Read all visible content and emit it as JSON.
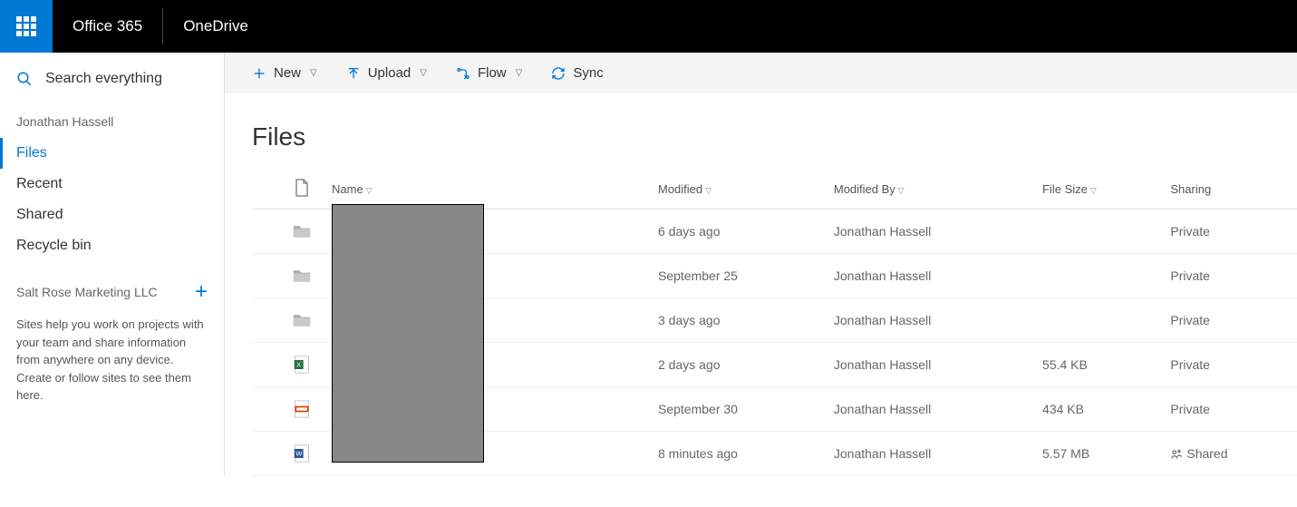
{
  "header": {
    "brand": "Office 365",
    "app": "OneDrive"
  },
  "search": {
    "placeholder": "Search everything"
  },
  "sidebar": {
    "owner": "Jonathan Hassell",
    "nav": [
      "Files",
      "Recent",
      "Shared",
      "Recycle bin"
    ],
    "group_label": "Salt Rose Marketing LLC",
    "help": "Sites help you work on projects with your team and share information from anywhere on any device. Create or follow sites to see them here."
  },
  "commands": {
    "new": "New",
    "upload": "Upload",
    "flow": "Flow",
    "sync": "Sync"
  },
  "page_title": "Files",
  "columns": {
    "name": "Name",
    "modified": "Modified",
    "modified_by": "Modified By",
    "size": "File Size",
    "sharing": "Sharing"
  },
  "rows": [
    {
      "type": "folder",
      "modified": "6 days ago",
      "by": "Jonathan Hassell",
      "size": "",
      "sharing": "Private"
    },
    {
      "type": "folder",
      "modified": "September 25",
      "by": "Jonathan Hassell",
      "size": "",
      "sharing": "Private"
    },
    {
      "type": "folder",
      "modified": "3 days ago",
      "by": "Jonathan Hassell",
      "size": "",
      "sharing": "Private"
    },
    {
      "type": "excel",
      "modified": "2 days ago",
      "by": "Jonathan Hassell",
      "size": "55.4 KB",
      "sharing": "Private"
    },
    {
      "type": "pdf",
      "modified": "September 30",
      "by": "Jonathan Hassell",
      "size": "434 KB",
      "sharing": "Private"
    },
    {
      "type": "word",
      "modified": "8 minutes ago",
      "by": "Jonathan Hassell",
      "size": "5.57 MB",
      "sharing": "Shared"
    }
  ]
}
